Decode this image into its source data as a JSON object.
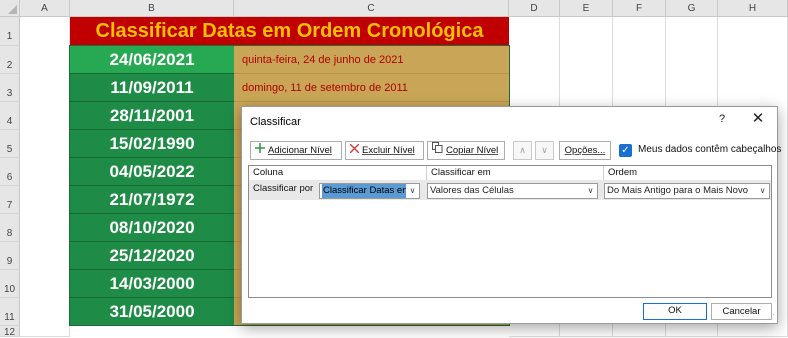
{
  "sheet": {
    "columns": [
      "A",
      "B",
      "C",
      "D",
      "E",
      "F",
      "G",
      "H"
    ],
    "rows": [
      "1",
      "2",
      "3",
      "4",
      "5",
      "6",
      "7",
      "8",
      "9",
      "10",
      "11",
      "12"
    ],
    "title": "Classificar Datas em Ordem Cronológica",
    "dates": [
      "24/06/2021",
      "11/09/2011",
      "28/11/2001",
      "15/02/1990",
      "04/05/2022",
      "21/07/1972",
      "08/10/2020",
      "25/12/2020",
      "14/03/2000",
      "31/05/2000"
    ],
    "long_dates": [
      "quinta-feira, 24 de junho de 2021",
      "domingo, 11 de setembro de 2011"
    ],
    "colors": {
      "title_bg": "#c00000",
      "title_text": "#ffc000",
      "date_bg": "#1e8c46",
      "longdate_bg": "#c9a657",
      "longdate_text": "#b00000"
    }
  },
  "dialog": {
    "title": "Classificar",
    "help": "?",
    "close": "✕",
    "toolbar": {
      "add_level": "Adicionar Nível",
      "delete_level": "Excluir Nível",
      "copy_level": "Copiar Nível",
      "move_up": "∧",
      "move_down": "∨",
      "options": "Opções...",
      "headers_checkbox": "Meus dados contêm cabeçalhos",
      "headers_checked": true
    },
    "table": {
      "headers": [
        "Coluna",
        "Classificar em",
        "Ordem"
      ],
      "row_label": "Classificar por",
      "column_value": "Classificar Datas en",
      "sort_on_value": "Valores das Células",
      "order_value": "Do Mais Antigo para o Mais Novo"
    },
    "ok": "OK",
    "cancel": "Cancelar",
    "accent_color": "#1a6fd1"
  }
}
